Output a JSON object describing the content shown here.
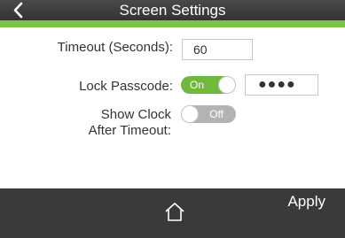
{
  "header": {
    "title": "Screen Settings",
    "back_icon": "chevron-left-icon"
  },
  "accent_color": "#7ec24a",
  "form": {
    "timeout": {
      "label": "Timeout (Seconds):",
      "value": "60"
    },
    "lock_passcode": {
      "label": "Lock Passcode:",
      "toggle_label": "On",
      "enabled": true,
      "masked_value": "●●●●"
    },
    "show_clock": {
      "label_line1": "Show Clock",
      "label_line2": "After Timeout:",
      "toggle_label": "Off",
      "enabled": false
    }
  },
  "footer": {
    "home_icon": "home-icon",
    "apply_label": "Apply"
  }
}
